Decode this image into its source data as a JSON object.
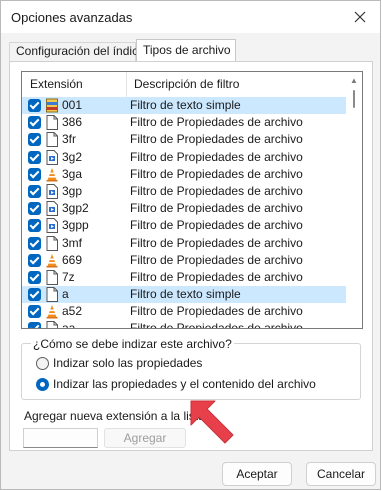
{
  "window": {
    "title": "Opciones avanzadas",
    "close_icon": "close-icon"
  },
  "tabs": [
    {
      "label": "Configuración del índice",
      "active": false
    },
    {
      "label": "Tipos de archivo",
      "active": true
    }
  ],
  "list": {
    "headers": {
      "extension": "Extensión",
      "description": "Descripción de filtro"
    },
    "rows": [
      {
        "ext": "001",
        "desc": "Filtro de texto simple",
        "checked": true,
        "icon": "archive-icon",
        "selected": true
      },
      {
        "ext": "386",
        "desc": "Filtro de Propiedades de archivo",
        "checked": true,
        "icon": "file-icon"
      },
      {
        "ext": "3fr",
        "desc": "Filtro de Propiedades de archivo",
        "checked": true,
        "icon": "file-icon"
      },
      {
        "ext": "3g2",
        "desc": "Filtro de Propiedades de archivo",
        "checked": true,
        "icon": "video-file-icon"
      },
      {
        "ext": "3ga",
        "desc": "Filtro de Propiedades de archivo",
        "checked": true,
        "icon": "vlc-cone-icon"
      },
      {
        "ext": "3gp",
        "desc": "Filtro de Propiedades de archivo",
        "checked": true,
        "icon": "video-file-icon"
      },
      {
        "ext": "3gp2",
        "desc": "Filtro de Propiedades de archivo",
        "checked": true,
        "icon": "video-file-icon"
      },
      {
        "ext": "3gpp",
        "desc": "Filtro de Propiedades de archivo",
        "checked": true,
        "icon": "video-file-icon"
      },
      {
        "ext": "3mf",
        "desc": "Filtro de Propiedades de archivo",
        "checked": true,
        "icon": "file-icon"
      },
      {
        "ext": "669",
        "desc": "Filtro de Propiedades de archivo",
        "checked": true,
        "icon": "vlc-cone-icon"
      },
      {
        "ext": "7z",
        "desc": "Filtro de Propiedades de archivo",
        "checked": true,
        "icon": "file-icon"
      },
      {
        "ext": "a",
        "desc": "Filtro de texto simple",
        "checked": true,
        "icon": "file-icon",
        "selected": true
      },
      {
        "ext": "a52",
        "desc": "Filtro de Propiedades de archivo",
        "checked": true,
        "icon": "vlc-cone-icon"
      },
      {
        "ext": "aa",
        "desc": "Filtro de Propiedades de archivo",
        "checked": true,
        "icon": "file-icon"
      }
    ]
  },
  "index_group": {
    "label": "¿Cómo se debe indizar este archivo?",
    "options": [
      {
        "label": "Indizar solo las propiedades",
        "selected": false
      },
      {
        "label": "Indizar las propiedades y el contenido del archivo",
        "selected": true
      }
    ]
  },
  "add": {
    "label": "Agregar nueva extensión a la lista:",
    "value": "",
    "button": "Agregar"
  },
  "buttons": {
    "ok": "Aceptar",
    "cancel": "Cancelar"
  },
  "colors": {
    "accent": "#0067c0",
    "selection": "#cce8ff",
    "arrow": "#e8404a"
  }
}
